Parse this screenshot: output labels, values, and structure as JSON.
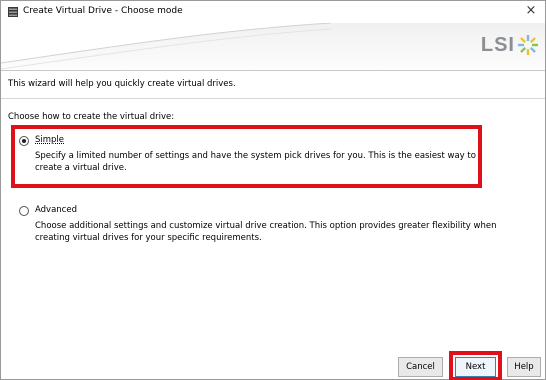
{
  "window": {
    "title": "Create Virtual Drive - Choose mode",
    "close_glyph": "×"
  },
  "banner": {
    "brand": "LSI"
  },
  "intro": "This wizard will help you quickly create virtual drives.",
  "prompt": "Choose how to create the virtual drive:",
  "options": [
    {
      "label": "Simple",
      "selected": true,
      "description": "Specify a limited number of settings and have the system pick drives for you. This is the easiest way to create a virtual drive."
    },
    {
      "label": "Advanced",
      "selected": false,
      "description": "Choose additional settings and customize virtual drive creation. This option provides greater flexibility when creating virtual drives for your specific requirements."
    }
  ],
  "buttons": {
    "cancel": "Cancel",
    "next": "Next",
    "help": "Help"
  },
  "colors": {
    "highlight": "#e0101b",
    "brand_text": "#8a8f94"
  },
  "icons": {
    "app": "server-drive-icon",
    "brand": "lsi-star-logo-icon",
    "close": "close-icon"
  }
}
